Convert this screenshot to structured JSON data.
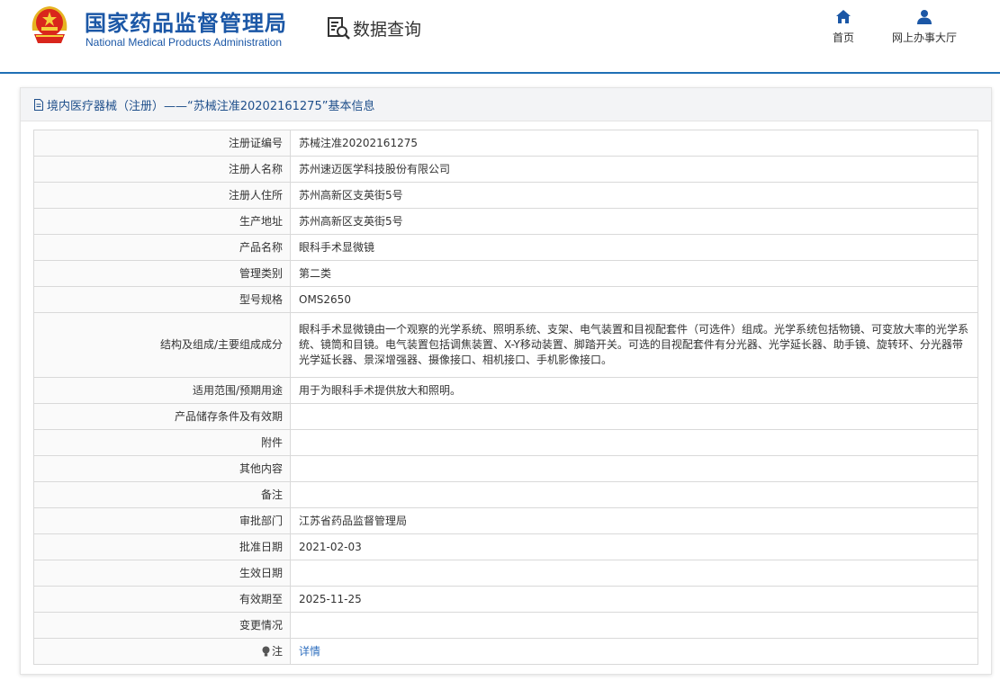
{
  "header": {
    "org_name_cn": "国家药品监督管理局",
    "org_name_en": "National Medical Products Administration",
    "data_query": "数据查询",
    "nav": {
      "home": "首页",
      "online_hall": "网上办事大厅"
    }
  },
  "panel": {
    "title": "境内医疗器械（注册）——“苏械注准20202161275”基本信息"
  },
  "rows": [
    {
      "label": "注册证编号",
      "value": "苏械注准20202161275"
    },
    {
      "label": "注册人名称",
      "value": "苏州速迈医学科技股份有限公司"
    },
    {
      "label": "注册人住所",
      "value": "苏州高新区支英街5号"
    },
    {
      "label": "生产地址",
      "value": "苏州高新区支英街5号"
    },
    {
      "label": "产品名称",
      "value": "眼科手术显微镜"
    },
    {
      "label": "管理类别",
      "value": "第二类"
    },
    {
      "label": "型号规格",
      "value": "OMS2650"
    },
    {
      "label": "结构及组成/主要组成成分",
      "value": "眼科手术显微镜由一个观察的光学系统、照明系统、支架、电气装置和目视配套件（可选件）组成。光学系统包括物镜、可变放大率的光学系统、镜筒和目镜。电气装置包括调焦装置、X-Y移动装置、脚踏开关。可选的目视配套件有分光器、光学延长器、助手镜、旋转环、分光器带光学延长器、景深增强器、摄像接口、相机接口、手机影像接口。"
    },
    {
      "label": "适用范围/预期用途",
      "value": "用于为眼科手术提供放大和照明。"
    },
    {
      "label": "产品储存条件及有效期",
      "value": ""
    },
    {
      "label": "附件",
      "value": ""
    },
    {
      "label": "其他内容",
      "value": ""
    },
    {
      "label": "备注",
      "value": ""
    },
    {
      "label": "审批部门",
      "value": "江苏省药品监督管理局"
    },
    {
      "label": "批准日期",
      "value": "2021-02-03"
    },
    {
      "label": "生效日期",
      "value": ""
    },
    {
      "label": "有效期至",
      "value": "2025-11-25"
    },
    {
      "label": "变更情况",
      "value": ""
    },
    {
      "label": "注",
      "value": "详情"
    }
  ],
  "colors": {
    "brand_blue": "#1b57a6",
    "link_blue": "#2f6fbf",
    "divider": "#1f6fb5"
  },
  "icons": {
    "emblem": "national-emblem-icon",
    "data_query": "document-search-icon",
    "home": "home-icon",
    "online_hall": "user-icon",
    "title": "document-icon",
    "note": "note-bulb-icon"
  }
}
